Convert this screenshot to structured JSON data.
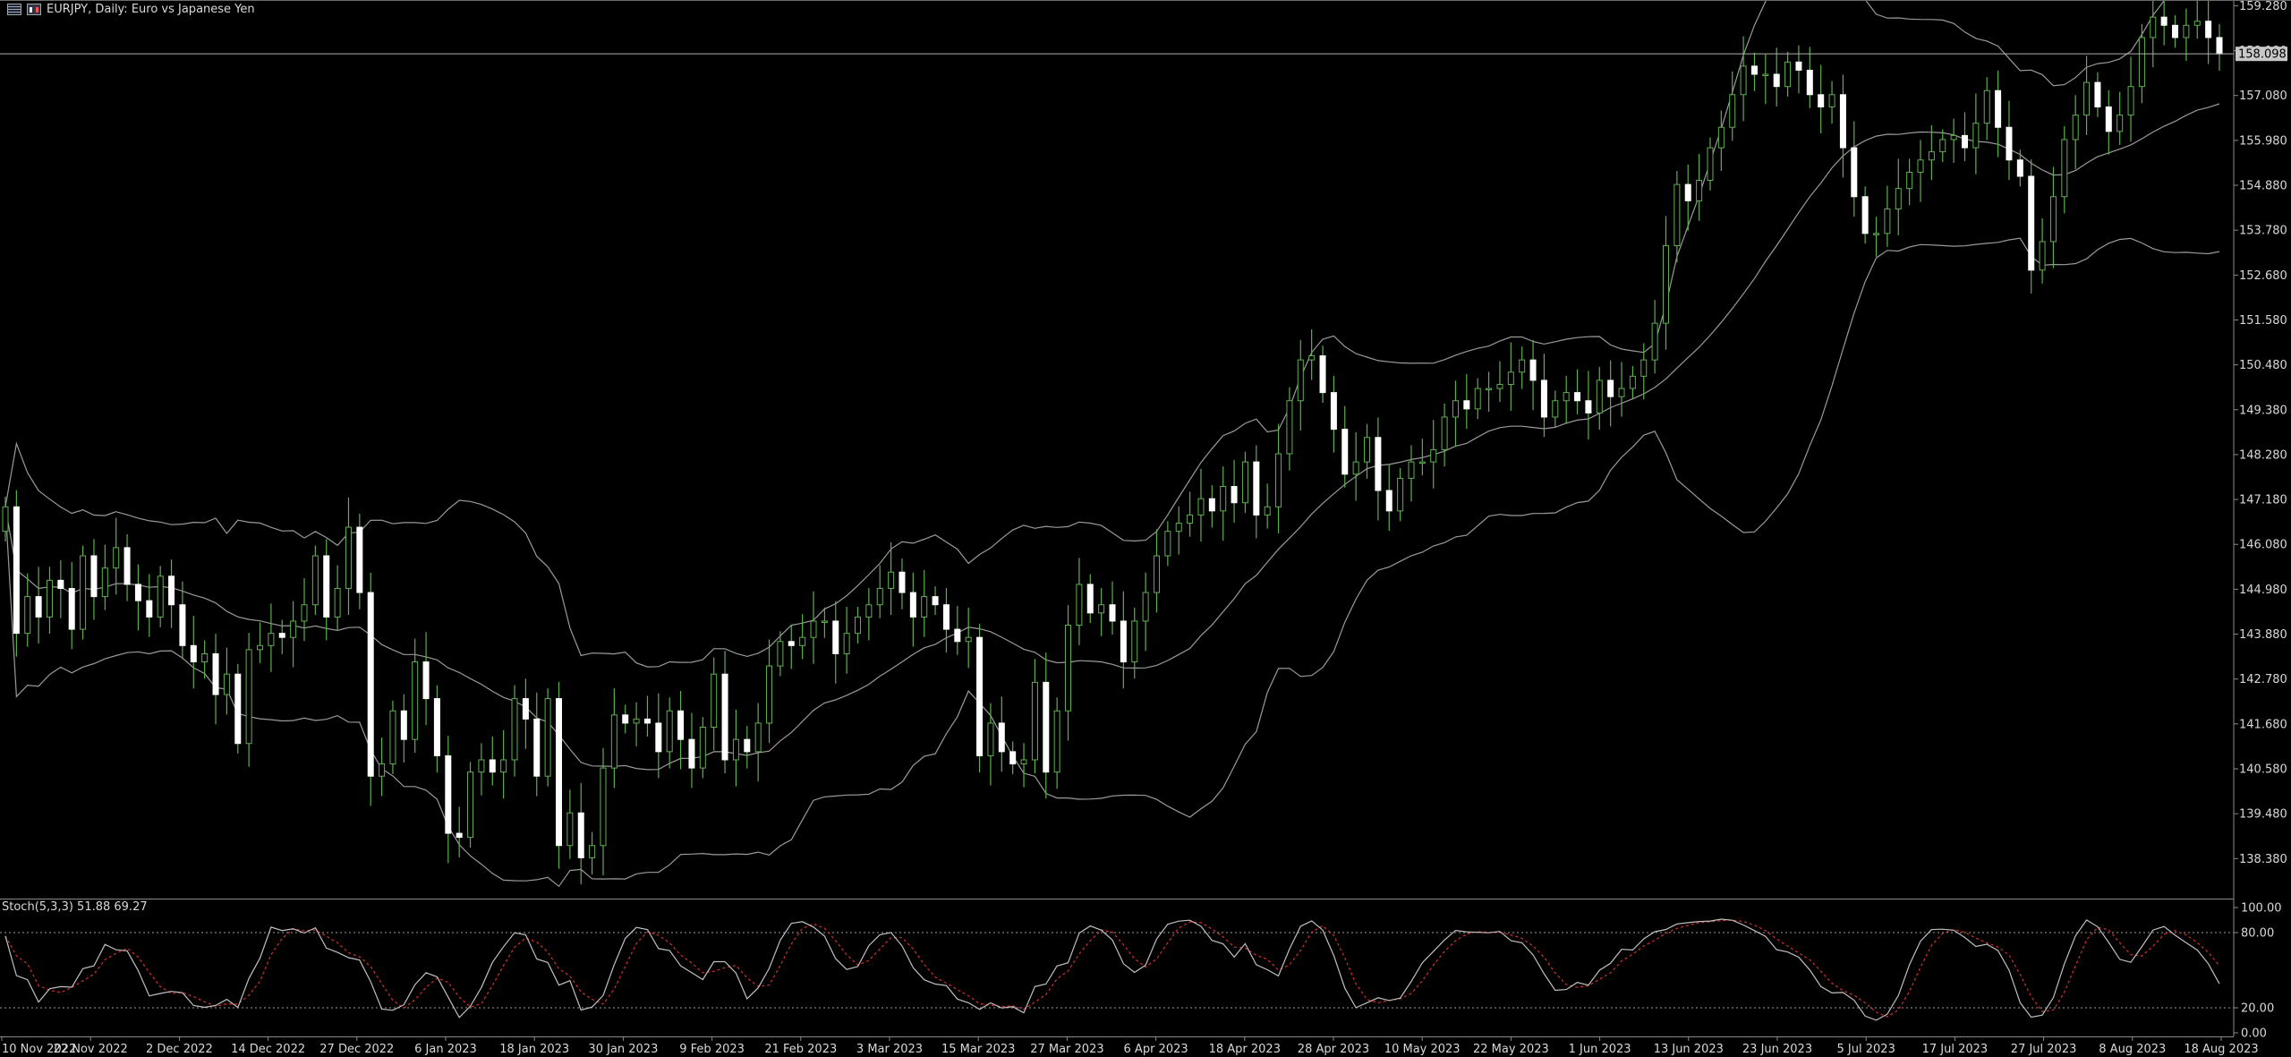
{
  "header": {
    "symbol_line": "EURJPY, Daily:  Euro vs Japanese Yen"
  },
  "colors": {
    "background": "#000000",
    "bull_candle": "#000000",
    "bull_outline": "#5fae4f",
    "bear_candle": "#ffffff",
    "wick": "#5fae4f",
    "bands": "#9a9a9a",
    "stoch_main": "#c0c0c0",
    "stoch_signal": "#d23030",
    "price_line": "#b0b0b0",
    "axis_text": "#d8d8d8"
  },
  "chart_data": [
    {
      "type": "candlestick",
      "title": "EURJPY, Daily:  Euro vs Japanese Yen",
      "y_ticks": [
        "159.280",
        "158.180",
        "157.080",
        "155.980",
        "154.880",
        "153.780",
        "152.680",
        "151.580",
        "150.480",
        "149.380",
        "148.280",
        "147.180",
        "146.080",
        "144.980",
        "143.880",
        "142.780",
        "141.680",
        "140.580",
        "139.480",
        "138.380"
      ],
      "ylim": [
        137.4,
        159.42
      ],
      "current_price": "158.098",
      "current_price_value": 158.1,
      "x_ticks": [
        "10 Nov 2022",
        "22 Nov 2022",
        "2 Dec 2022",
        "14 Dec 2022",
        "27 Dec 2022",
        "6 Jan 2023",
        "18 Jan 2023",
        "30 Jan 2023",
        "9 Feb 2023",
        "21 Feb 2023",
        "3 Mar 2023",
        "15 Mar 2023",
        "27 Mar 2023",
        "6 Apr 2023",
        "18 Apr 2023",
        "28 Apr 2023",
        "10 May 2023",
        "22 May 2023",
        "1 Jun 2023",
        "13 Jun 2023",
        "23 Jun 2023",
        "5 Jul 2023",
        "17 Jul 2023",
        "27 Jul 2023",
        "8 Aug 2023",
        "18 Aug 2023"
      ],
      "close": [
        147.0,
        143.9,
        144.8,
        144.3,
        145.2,
        145.0,
        144.0,
        145.8,
        144.8,
        145.5,
        146.0,
        145.1,
        144.7,
        144.3,
        145.3,
        144.6,
        143.6,
        143.2,
        143.4,
        142.4,
        142.9,
        141.2,
        143.5,
        143.6,
        143.9,
        143.8,
        144.2,
        144.6,
        145.8,
        144.3,
        145.0,
        146.5,
        144.9,
        140.4,
        140.7,
        142.0,
        141.3,
        143.2,
        142.3,
        140.9,
        139.0,
        138.9,
        140.5,
        140.8,
        140.5,
        140.8,
        142.3,
        141.8,
        140.4,
        142.3,
        138.7,
        139.5,
        138.4,
        138.7,
        140.6,
        141.9,
        141.7,
        141.8,
        141.7,
        141.0,
        142.0,
        141.3,
        140.6,
        141.6,
        142.9,
        140.8,
        141.3,
        141.0,
        141.7,
        143.1,
        143.7,
        143.6,
        143.8,
        144.2,
        144.2,
        143.4,
        143.9,
        144.3,
        144.6,
        145.0,
        145.4,
        144.9,
        144.3,
        144.8,
        144.6,
        144.0,
        143.7,
        143.8,
        140.9,
        141.7,
        141.0,
        140.7,
        140.8,
        142.7,
        140.5,
        142.0,
        144.1,
        145.1,
        144.4,
        144.6,
        144.2,
        143.2,
        144.2,
        144.9,
        145.8,
        146.4,
        146.6,
        146.8,
        147.2,
        146.9,
        147.5,
        147.1,
        148.1,
        146.8,
        147.0,
        148.3,
        149.6,
        150.6,
        150.7,
        149.8,
        148.9,
        147.8,
        148.1,
        148.7,
        147.4,
        146.9,
        147.7,
        148.1,
        148.1,
        148.4,
        149.2,
        149.6,
        149.4,
        149.9,
        149.9,
        150.0,
        150.3,
        150.6,
        150.1,
        149.2,
        149.6,
        149.8,
        149.6,
        149.3,
        150.1,
        149.7,
        149.9,
        150.2,
        150.6,
        151.5,
        153.4,
        154.9,
        154.5,
        155.0,
        155.8,
        156.3,
        157.1,
        157.8,
        157.6,
        157.6,
        157.3,
        157.9,
        157.7,
        157.1,
        156.8,
        157.1,
        155.8,
        154.6,
        153.7,
        153.7,
        154.3,
        154.8,
        155.2,
        155.5,
        155.7,
        156.0,
        156.1,
        155.8,
        156.4,
        157.2,
        156.3,
        155.5,
        155.1,
        152.8,
        153.5,
        154.6,
        156.0,
        156.6,
        157.4,
        156.8,
        156.2,
        156.6,
        157.3,
        158.5,
        159.0,
        158.8,
        158.5,
        158.8,
        158.9,
        158.5,
        158.1
      ],
      "series": [
        {
          "kind": "bollinger_upper"
        },
        {
          "kind": "bollinger_middle"
        },
        {
          "kind": "bollinger_lower"
        }
      ]
    },
    {
      "type": "line",
      "title": "Stoch(5,3,3) 51.88 69.27",
      "indicator": "Stoch(5,3,3)",
      "main_value": "51.88",
      "signal_value": "69.27",
      "y_ticks": [
        "100.00",
        "80.00",
        "20.00",
        "0.00"
      ],
      "ylim": [
        0,
        100
      ],
      "levels": [
        80,
        20
      ],
      "series": [
        {
          "kind": "stoch_main",
          "period": 5,
          "slowing": 3
        },
        {
          "kind": "stoch_signal",
          "period": 3
        }
      ]
    }
  ]
}
